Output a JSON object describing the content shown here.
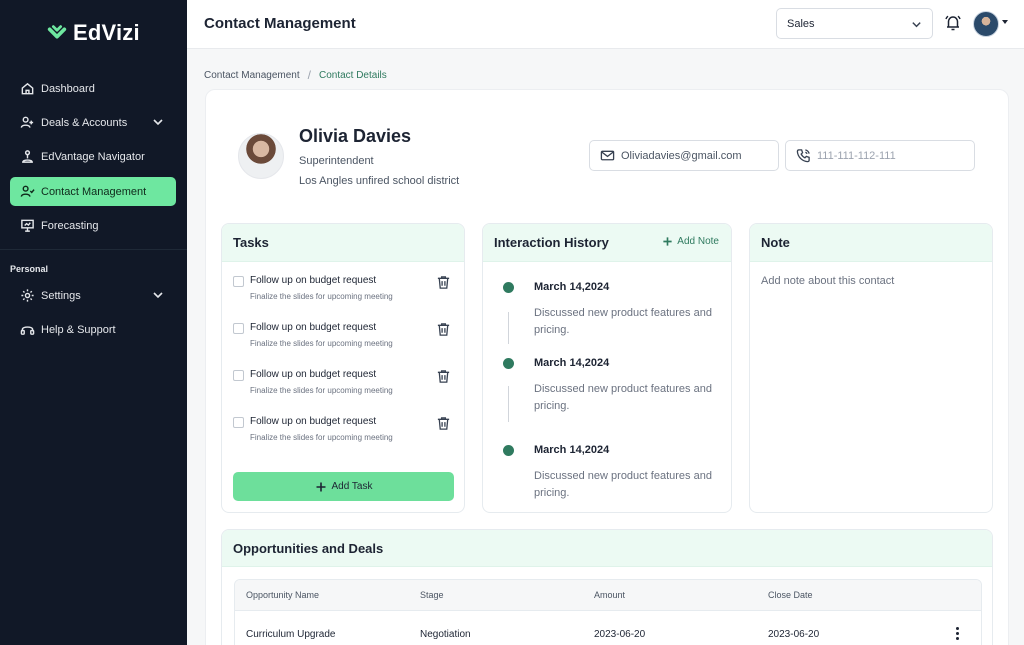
{
  "app": {
    "brand": "EdVizi"
  },
  "sidebar": {
    "items": [
      {
        "label": "Dashboard",
        "icon": "home-icon"
      },
      {
        "label": "Deals & Accounts",
        "icon": "users-icon"
      },
      {
        "label": "EdVantage Navigator",
        "icon": "navigator-icon"
      },
      {
        "label": "Contact Management",
        "icon": "contact-icon",
        "active": true
      },
      {
        "label": "Forecasting",
        "icon": "presentation-icon"
      }
    ],
    "section_label": "Personal",
    "personal_items": [
      {
        "label": "Settings",
        "icon": "gear-icon"
      },
      {
        "label": "Help & Support",
        "icon": "headset-icon"
      }
    ]
  },
  "header": {
    "title": "Contact Management",
    "select_value": "Sales"
  },
  "breadcrumb": {
    "parent": "Contact Management",
    "separator": "/",
    "current": "Contact Details"
  },
  "contact": {
    "name": "Olivia Davies",
    "role": "Superintendent",
    "organization": "Los Angles unfired school district",
    "email": "Oliviadavies@gmail.com",
    "phone": "111-111-112-111"
  },
  "tasks": {
    "title": "Tasks",
    "items": [
      {
        "title": "Follow up on budget request",
        "description": "Finalize the slides for upcoming meeting"
      },
      {
        "title": "Follow up on budget request",
        "description": "Finalize the slides for upcoming meeting"
      },
      {
        "title": "Follow up on budget request",
        "description": "Finalize the slides for upcoming meeting"
      },
      {
        "title": "Follow up on budget request",
        "description": "Finalize the slides for upcoming meeting"
      }
    ],
    "add_label": "Add Task"
  },
  "history": {
    "title": "Interaction History",
    "add_label": "Add Note",
    "items": [
      {
        "date": "March 14,2024",
        "text": "Discussed new product features and pricing."
      },
      {
        "date": "March 14,2024",
        "text": "Discussed new product features and pricing."
      },
      {
        "date": "March 14,2024",
        "text": "Discussed new product features and pricing."
      }
    ]
  },
  "note": {
    "title": "Note",
    "placeholder": "Add note about this contact"
  },
  "opportunities": {
    "title": "Opportunities and Deals",
    "columns": [
      "Opportunity Name",
      "Stage",
      "Amount",
      "Close Date"
    ],
    "rows": [
      [
        "Curriculum Upgrade",
        "Negotiation",
        "2023-06-20",
        "2023-06-20"
      ]
    ]
  },
  "colors": {
    "accent": "#6ee7a0",
    "brand_dark": "#111827",
    "primary_text": "#1d2433",
    "link": "#2f7a5f"
  }
}
